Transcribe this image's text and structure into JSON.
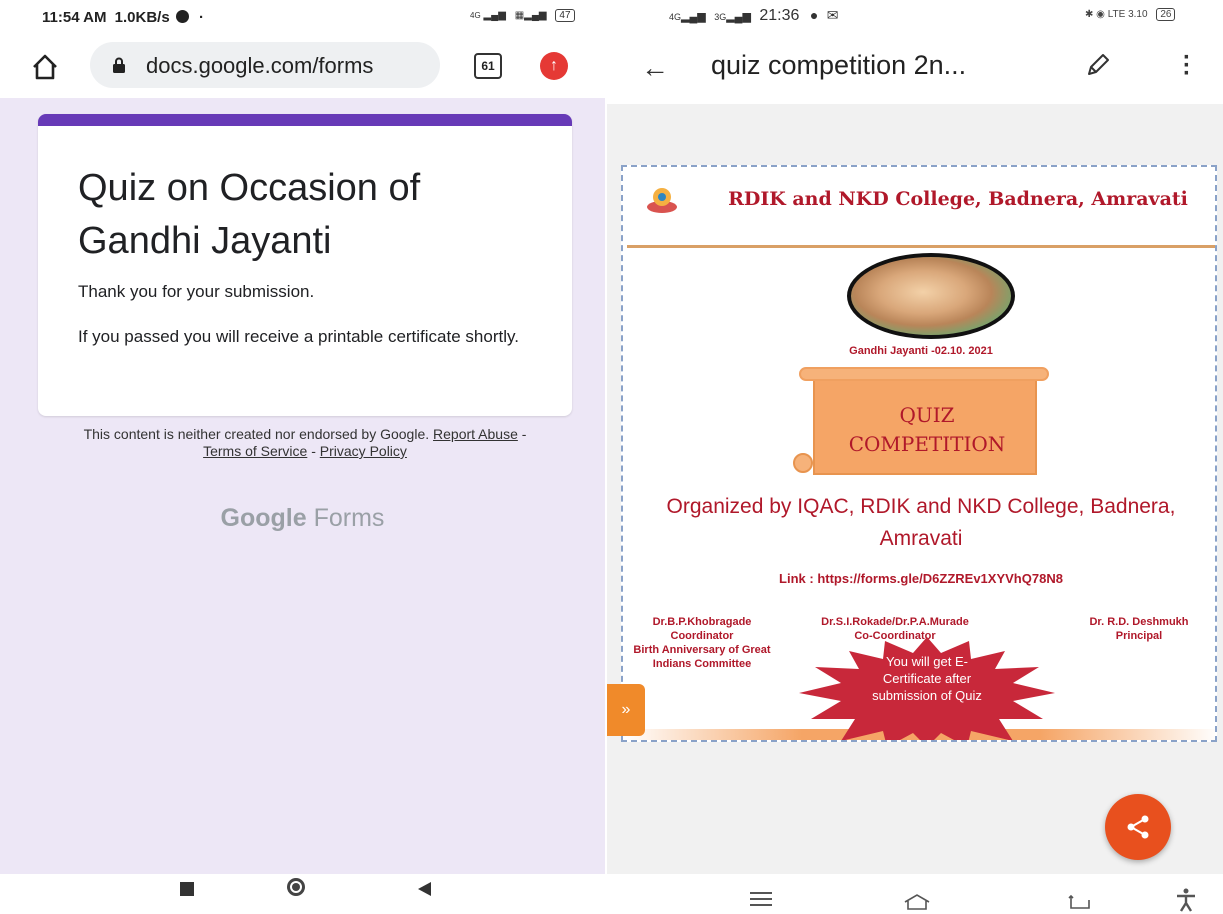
{
  "left_screen": {
    "status_bar": {
      "time": "11:54 AM",
      "speed": "1.0KB/s",
      "signal_info": "4G",
      "battery": "47"
    },
    "browser": {
      "url": "docs.google.com/forms",
      "tab_count": "61"
    },
    "form": {
      "title": "Quiz on Occasion of Gandhi Jayanti",
      "message_submitted": "Thank you for your submission.",
      "message_certificate": "If you passed you will receive a printable certificate shortly.",
      "disclaimer_prefix": "This content is neither created nor endorsed by Google.",
      "report_abuse": "Report Abuse",
      "terms": "Terms of Service",
      "privacy": "Privacy Policy",
      "separator": "-",
      "brand_google": "Google",
      "brand_forms": "Forms"
    }
  },
  "right_screen": {
    "status_bar": {
      "network": "4G",
      "network2": "3G",
      "time": "21:36",
      "speed": "3.10",
      "battery": "26"
    },
    "app_bar": {
      "title": "quiz competition 2n..."
    },
    "poster": {
      "college": "RDIK and NKD College, Badnera, Amravati",
      "date_line": "Gandhi Jayanti -02.10. 2021",
      "quiz_line1": "QUIZ",
      "quiz_line2": "COMPETITION",
      "organized": "Organized by IQAC, RDIK and NKD College, Badnera, Amravati",
      "link": "Link : https://forms.gle/D6ZZREv1XYVhQ78N8",
      "sig1_name": "Dr.B.P.Khobragade",
      "sig1_role": "Coordinator",
      "sig1_extra": "Birth Anniversary of Great Indians Committee",
      "sig2_name": "Dr.S.I.Rokade/Dr.P.A.Murade",
      "sig2_role": "Co-Coordinator",
      "sig3_name": "Dr. R.D. Deshmukh",
      "sig3_role": "Principal",
      "badge": "You will get E-Certificate after submission of Quiz"
    },
    "side_tab": "»"
  },
  "colors": {
    "form_accent": "#673ab7",
    "form_bg": "#ede7f6",
    "poster_red": "#b0182a",
    "poster_orange": "#f5a566",
    "fab": "#e8501e"
  }
}
